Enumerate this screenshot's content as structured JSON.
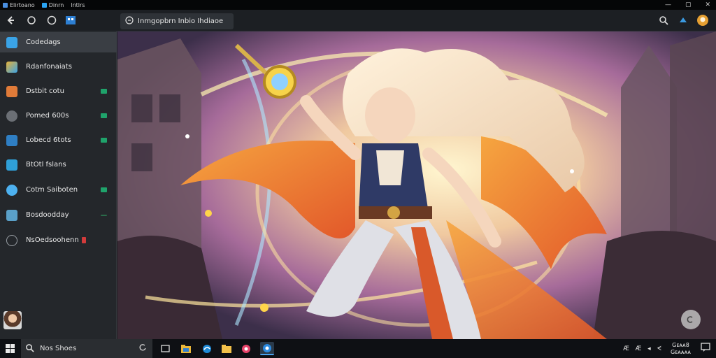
{
  "titlebar": {
    "items": [
      {
        "label": "Elirtoano",
        "color": "#4a8fe0"
      },
      {
        "label": "Dinrn",
        "color": "#2aa4f4"
      },
      {
        "label": "lntlrs",
        "color": ""
      }
    ]
  },
  "toolbar": {
    "tab_label": "Inmgopbrn Inbio Ihdiaoe",
    "icons": [
      "back-icon",
      "chat-icon",
      "circle-icon",
      "store-icon"
    ]
  },
  "sidebar": {
    "items": [
      {
        "label": "Codedags",
        "icon": "cube-icon",
        "color": "#3aa3e6",
        "badge": ""
      },
      {
        "label": "Rdanfonaiats",
        "icon": "palette-icon",
        "color": "#e8b338",
        "badge": ""
      },
      {
        "label": "Dstbit cotu",
        "icon": "folder-icon",
        "color": "#e07b39",
        "badge": "#1fa36b"
      },
      {
        "label": "Pomed 600s",
        "icon": "shield-icon",
        "color": "#6b6f75",
        "badge": "#1fa36b"
      },
      {
        "label": "Lobecd 6tots",
        "icon": "building-icon",
        "color": "#2f7fc4",
        "badge": "#1fa36b"
      },
      {
        "label": "BtOtl fslans",
        "icon": "box-icon",
        "color": "#2fa0d8",
        "badge": ""
      },
      {
        "label": "Cotm Saiboten",
        "icon": "bird-icon",
        "color": "#4db1f0",
        "badge": "#1fa36b"
      },
      {
        "label": "Bosdoodday",
        "icon": "card-icon",
        "color": "#5aa0c8",
        "badge": "#2a6b4a"
      },
      {
        "label": "NsOedsoohenn",
        "icon": "settings-icon",
        "color": "#9aa0a6",
        "badge": "#d23b3b"
      }
    ]
  },
  "taskbar": {
    "search_text": "Nos Shoes",
    "tray_text": "Æ  Æ  ◂  ᗕ",
    "clock_line1": "Gᴇᴀᴀ8",
    "clock_line2": "Gᴇᴀᴀᴀᴀ"
  }
}
